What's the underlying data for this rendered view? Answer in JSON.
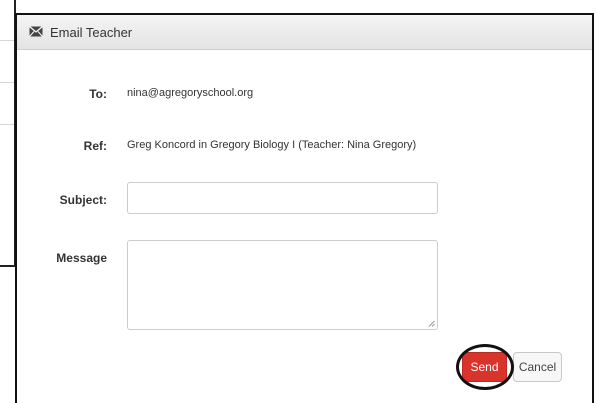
{
  "dialog": {
    "title": "Email Teacher",
    "icon": "envelope-icon"
  },
  "form": {
    "to_label": "To:",
    "to_value": "nina@agregoryschool.org",
    "ref_label": "Ref:",
    "ref_value": "Greg Koncord in Gregory Biology I (Teacher: Nina Gregory)",
    "subject_label": "Subject:",
    "subject_value": "",
    "message_label": "Message",
    "message_value": ""
  },
  "buttons": {
    "send_label": "Send",
    "cancel_label": "Cancel"
  },
  "colors": {
    "send": "#d9342b",
    "header": "#ececec"
  }
}
